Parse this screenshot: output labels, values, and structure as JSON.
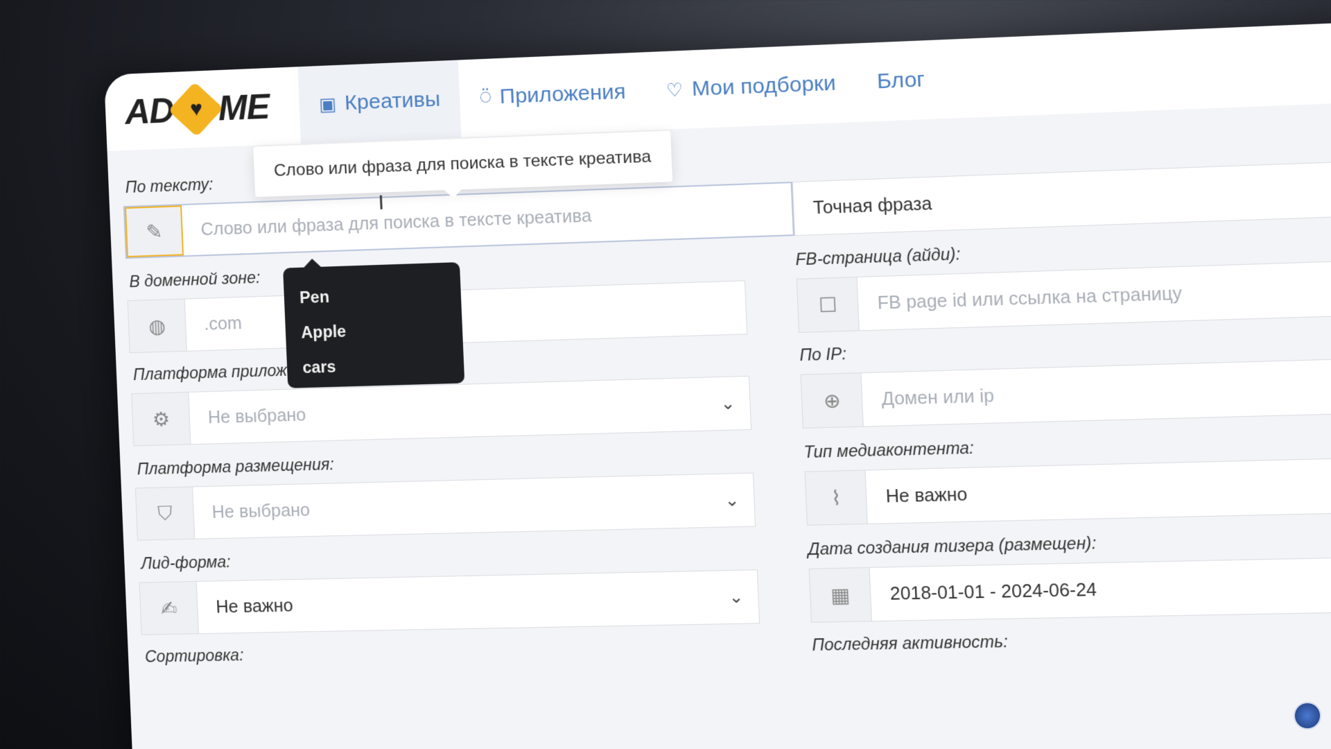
{
  "nav": {
    "logo_left": "AD",
    "logo_right": "ME",
    "tabs": [
      {
        "label": "Креативы",
        "icon": "image-icon",
        "active": true
      },
      {
        "label": "Приложения",
        "icon": "apple-icon",
        "active": false
      },
      {
        "label": "Мои подборки",
        "icon": "heart-icon",
        "active": false
      },
      {
        "label": "Блог",
        "icon": "",
        "active": false
      }
    ]
  },
  "tooltip": "Слово или фраза для поиска в тексте креатива",
  "search_text": {
    "label": "По тексту:",
    "placeholder": "Слово или фраза для поиска в тексте креатива",
    "mode": "Точная фраза"
  },
  "autocomplete": [
    "Pen",
    "Apple",
    "cars"
  ],
  "domain_zone": {
    "label": "В доменной зоне:",
    "placeholder": ".com"
  },
  "fb_page": {
    "label": "FB-страница (айди):",
    "placeholder": "FB page id или ссылка на страницу"
  },
  "app_platform": {
    "label": "Платформа приложени",
    "value": "Не выбрано"
  },
  "ip": {
    "label": "По IP:",
    "placeholder": "Домен или  ip"
  },
  "placement_platform": {
    "label": "Платформа размещения:",
    "value": "Не выбрано"
  },
  "media_type": {
    "label": "Тип медиаконтента:",
    "value": "Не важно"
  },
  "lead_form": {
    "label": "Лид-форма:",
    "value": "Не важно"
  },
  "teaser_date": {
    "label": "Дата создания тизера (размещен):",
    "value": "2018-01-01 - 2024-06-24"
  },
  "sort": {
    "label": "Сортировка:"
  },
  "last_activity": {
    "label": "Последняя активность:"
  },
  "colors": {
    "accent": "#f4b320",
    "link": "#4a7ec2",
    "dropdown_bg": "#1e1f22"
  }
}
